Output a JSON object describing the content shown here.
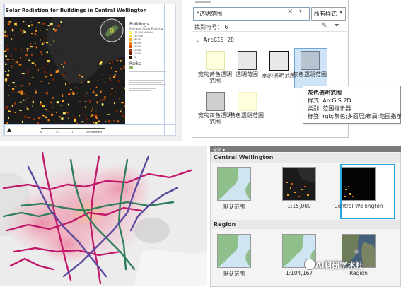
{
  "layout_panel": {
    "title": "Solar Radiation for Buildings in Central Wellington",
    "legend": {
      "buildings_heading": "Buildings",
      "buildings_subtitle": "Average Yearly Potential",
      "classes": [
        {
          "label": "12,000 kWh/m²",
          "color": "#fff36b"
        },
        {
          "label": "10,000",
          "color": "#ffcf40"
        },
        {
          "label": "8,000",
          "color": "#ffa31a"
        },
        {
          "label": "6,000",
          "color": "#f07c12"
        },
        {
          "label": "4,000",
          "color": "#d9530d"
        },
        {
          "label": "2,000",
          "color": "#a83508"
        },
        {
          "label": "1,000",
          "color": "#6e1e04"
        },
        {
          "label": "0",
          "color": "#3b0f02"
        }
      ],
      "parks_heading": "Parks"
    },
    "scale_labels": [
      "0",
      "0.5",
      "1",
      "2 Kilometers"
    ],
    "north_label": "N"
  },
  "styles_panel": {
    "search_value": "*透明范围",
    "style_filter": "所有样式",
    "found_count_text": "找到符号： 6",
    "group_title": "ArcGIS 2D",
    "symbols": [
      {
        "label": "宽的黄色透明范围",
        "fill": "#ffffdd",
        "border": "#e6e6a8"
      },
      {
        "label": "透明范围",
        "fill": "#e8e8e8",
        "border": "#333333"
      },
      {
        "label": "宽的透明范围",
        "fill": "#e8e8e8",
        "border": "#111111"
      },
      {
        "label": "灰色透明范围",
        "fill": "#b8c4d0",
        "border": "#6a7a8a"
      },
      {
        "label": "宽的灰色透明范围",
        "fill": "#cfcfcf",
        "border": "#777777"
      },
      {
        "label": "黄色透明范围",
        "fill": "#ffffdd",
        "border": "#f0f0c0"
      }
    ],
    "tooltip": {
      "title": "灰色透明范围",
      "style_line": "样式: ArcGIS 2D",
      "class_line": "类别: 范围指示器",
      "tags_line": "标签: rgb;灰色;多面层;布局;范围指示器"
    }
  },
  "bookmarks_panel": {
    "all_label": "全部",
    "sections": [
      {
        "title": "Central Wellington",
        "items": [
          {
            "caption": "默认范围",
            "kind": "map-light"
          },
          {
            "caption": "1:15,000",
            "kind": "map-dark"
          },
          {
            "caption": "Central Wellington",
            "kind": "map-black",
            "selected": true
          }
        ]
      },
      {
        "title": "Region",
        "items": [
          {
            "caption": "默认范围",
            "kind": "map-light"
          },
          {
            "caption": "1:104,167",
            "kind": "map-light"
          },
          {
            "caption": "Region",
            "kind": "map-sat"
          }
        ]
      }
    ],
    "watermark": "AI科研学术社"
  },
  "colors": {
    "accent_blue": "#27a7e0",
    "selection_fill": "#cfe4f7",
    "route_magenta": "#c2186b",
    "route_green": "#2e7d5b",
    "route_purple": "#5b4a9e"
  }
}
